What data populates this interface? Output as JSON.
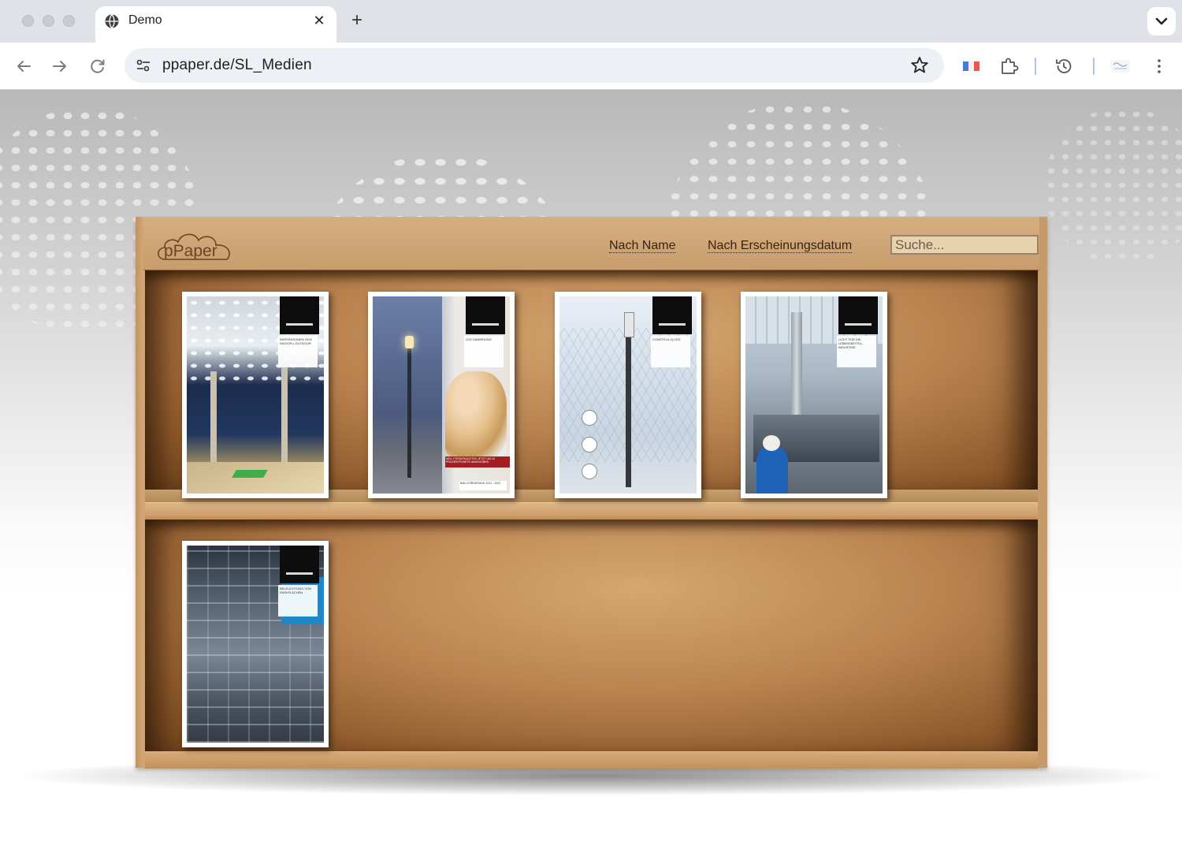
{
  "browser": {
    "tab": {
      "title": "Demo",
      "close_label": "✕"
    },
    "new_tab_label": "+",
    "url": "ppaper.de/SL_Medien"
  },
  "app": {
    "logo_text": "pPaper",
    "sort_by_name": "Nach Name",
    "sort_by_date": "Nach Erscheinungsdatum",
    "search_placeholder": "Suche..."
  },
  "shelves": [
    {
      "books": [
        {
          "title": "INSPIRATIONEN 2020 INDOOR | OUTDOOR"
        },
        {
          "title": "LED-SANIERUNG",
          "banner": "NEU: FÖRDERQUOTEN JETZT UM 15 PROZENTPUNKTE ANGEHOBEN",
          "footer": "BMU-FÖRDERUNG 2021 - 2022"
        },
        {
          "title": "CONSTELA IQ LED"
        },
        {
          "title": "LICHT FÜR DIE LEBENSMITTEL-INDUSTRIE"
        }
      ]
    },
    {
      "books": [
        {
          "title": "BELEUCHTUNG VON PARKFLÄCHEN"
        }
      ]
    }
  ],
  "colors": {
    "shelf_wood": "#c89d6d",
    "shelf_dark": "#6e421d",
    "link": "#3a2410",
    "search_bg": "#e8d2ae"
  }
}
